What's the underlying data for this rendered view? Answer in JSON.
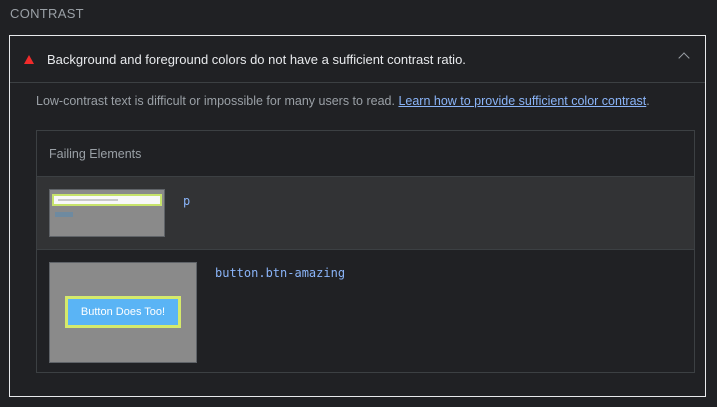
{
  "section": {
    "header": "CONTRAST"
  },
  "audit": {
    "title": "Background and foreground colors do not have a sufficient contrast ratio.",
    "description_prefix": "Low-contrast text is difficult or impossible for many users to read.",
    "learn_more_link": "Learn how to provide sufficient color contrast",
    "description_suffix": ".",
    "failing_title": "Failing Elements",
    "elements": [
      {
        "selector_tag": "p",
        "selector_class": ""
      },
      {
        "selector_tag": "button",
        "selector_class": ".btn-amazing",
        "thumb_button_text": "Button Does Too!"
      }
    ]
  },
  "colors": {
    "warning": "#f12b2b",
    "link": "#8ab4f8",
    "highlight": "#d5ea6b",
    "button": "#5ab4f5"
  }
}
